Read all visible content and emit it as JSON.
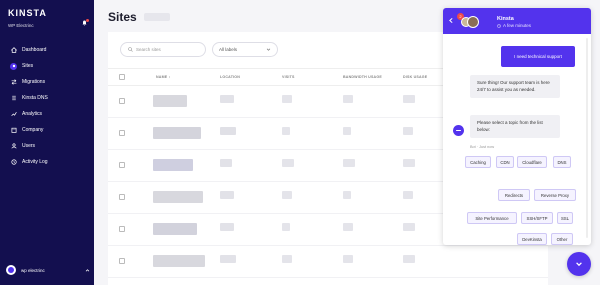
{
  "brand": {
    "logo": "KINSTA",
    "subtitle": "WP Electrinc"
  },
  "sidebar": {
    "items": [
      {
        "label": "Dashboard",
        "icon": "home-icon"
      },
      {
        "label": "Sites",
        "icon": "sites-icon",
        "active": true
      },
      {
        "label": "Migrations",
        "icon": "migrations-icon"
      },
      {
        "label": "Kinsta DNS",
        "icon": "dns-icon"
      },
      {
        "label": "Analytics",
        "icon": "analytics-icon"
      },
      {
        "label": "Company",
        "icon": "company-icon"
      },
      {
        "label": "Users",
        "icon": "users-icon"
      },
      {
        "label": "Activity Log",
        "icon": "activity-log-icon"
      }
    ],
    "account": "wp electrinc"
  },
  "main": {
    "title": "Sites",
    "search_placeholder": "Search sites",
    "labels_select": "All labels",
    "columns": {
      "name": "NAME ↕",
      "location": "LOCATION",
      "visits": "VISITS",
      "bandwidth": "BANDWIDTH USAGE",
      "disk": "DISK USAGE"
    }
  },
  "chat": {
    "agent_name": "Kinsta",
    "badge": "2",
    "time": "A few minutes",
    "user_message": "I need technical support",
    "bot_message_1": "Sure thing! Our support team is here 24/7 to assist you as needed.",
    "bot_message_2": "Please select a topic from the list below:",
    "bot_meta": "Bot · Just now",
    "options": [
      "Caching",
      "CDN",
      "Cloudflare",
      "DNS",
      "Redirects",
      "Reverse Proxy",
      "Site Performance",
      "SSH/SFTP",
      "SSL",
      "DevKinsta",
      "Other"
    ]
  },
  "colors": {
    "sidebar": "#130f4f",
    "accent": "#5333ed"
  }
}
